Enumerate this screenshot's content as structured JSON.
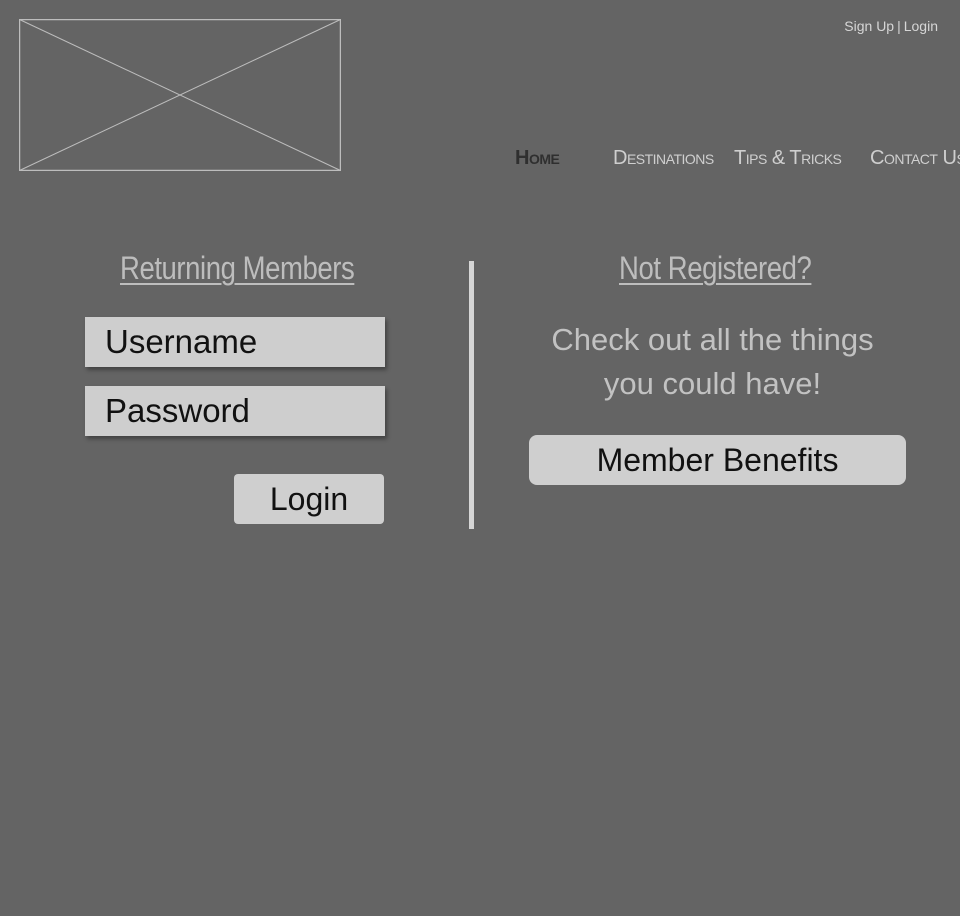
{
  "header": {
    "auth_links": {
      "sign_up": "Sign Up",
      "separator": "|",
      "login": "Login"
    },
    "nav": {
      "items": [
        {
          "label": "Home",
          "active": true
        },
        {
          "label": "Destinations",
          "active": false
        },
        {
          "label": "Tips & Tricks",
          "active": false
        },
        {
          "label": "Contact Us",
          "active": false
        }
      ]
    }
  },
  "returning_members": {
    "title": "Returning Members",
    "username_placeholder": "Username",
    "password_placeholder": "Password",
    "login_label": "Login"
  },
  "not_registered": {
    "title": "Not Registered?",
    "promo_lines": [
      "Check out all the things",
      "you could have!"
    ],
    "benefits_label": "Member Benefits"
  },
  "icons": {
    "logo": "image-placeholder-icon"
  },
  "colors": {
    "background": "#646464",
    "field_fill": "#cecece",
    "light_text": "#d6d6d6",
    "active_nav": "#2f2f2f"
  }
}
